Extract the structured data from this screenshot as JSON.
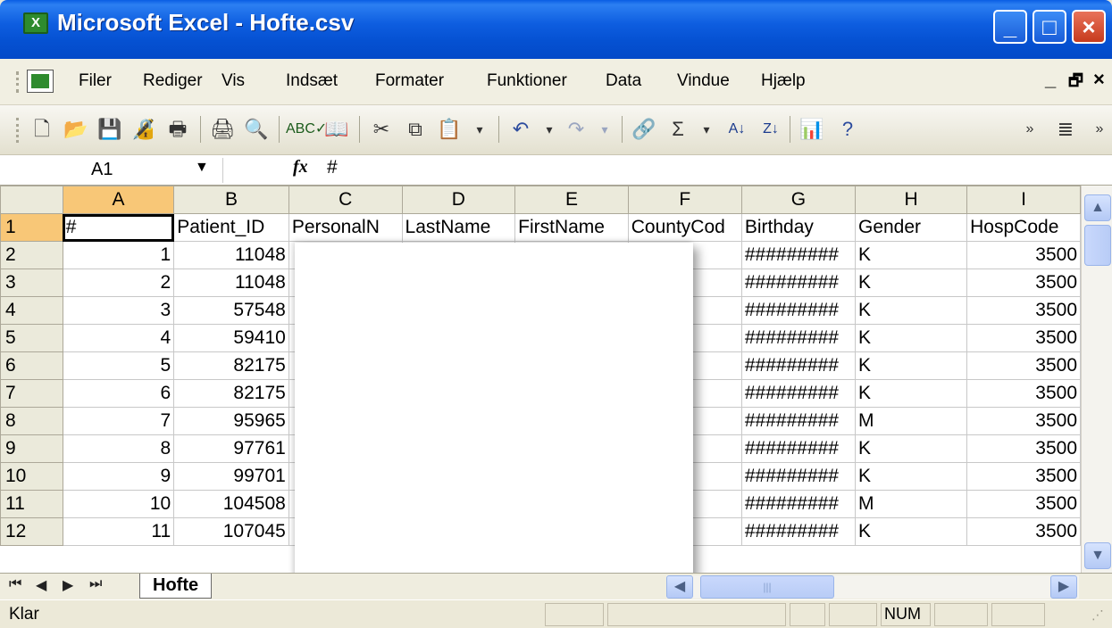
{
  "window": {
    "title": "Microsoft Excel - Hofte.csv"
  },
  "menu": {
    "items": [
      "Filer",
      "Rediger",
      "Vis",
      "Indsæt",
      "Formater",
      "Funktioner",
      "Data",
      "Vindue",
      "Hjælp"
    ]
  },
  "formula_bar": {
    "name_box": "A1",
    "fx": "fx",
    "value": "#"
  },
  "sheet": {
    "columns": [
      "A",
      "B",
      "C",
      "D",
      "E",
      "F",
      "G",
      "H",
      "I"
    ],
    "rows": [
      {
        "n": "1",
        "cells": [
          "#",
          "Patient_ID",
          "PersonalN",
          "LastName",
          "FirstName",
          "CountyCod",
          "Birthday",
          "Gender",
          "HospCode"
        ]
      },
      {
        "n": "2",
        "cells": [
          "1",
          "11048",
          "",
          "",
          "",
          "",
          "#########",
          "K",
          "3500"
        ]
      },
      {
        "n": "3",
        "cells": [
          "2",
          "11048",
          "",
          "",
          "",
          "",
          "#########",
          "K",
          "3500"
        ]
      },
      {
        "n": "4",
        "cells": [
          "3",
          "57548",
          "",
          "",
          "",
          "",
          "#########",
          "K",
          "3500"
        ]
      },
      {
        "n": "5",
        "cells": [
          "4",
          "59410",
          "",
          "",
          "",
          "",
          "#########",
          "K",
          "3500"
        ]
      },
      {
        "n": "6",
        "cells": [
          "5",
          "82175",
          "",
          "",
          "",
          "",
          "#########",
          "K",
          "3500"
        ]
      },
      {
        "n": "7",
        "cells": [
          "6",
          "82175",
          "",
          "",
          "",
          "",
          "#########",
          "K",
          "3500"
        ]
      },
      {
        "n": "8",
        "cells": [
          "7",
          "95965",
          "",
          "",
          "",
          "",
          "#########",
          "M",
          "3500"
        ]
      },
      {
        "n": "9",
        "cells": [
          "8",
          "97761",
          "",
          "",
          "",
          "",
          "#########",
          "K",
          "3500"
        ]
      },
      {
        "n": "10",
        "cells": [
          "9",
          "99701",
          "",
          "",
          "",
          "",
          "#########",
          "K",
          "3500"
        ]
      },
      {
        "n": "11",
        "cells": [
          "10",
          "104508",
          "",
          "",
          "",
          "",
          "#########",
          "M",
          "3500"
        ]
      },
      {
        "n": "12",
        "cells": [
          "11",
          "107045",
          "",
          "",
          "",
          "",
          "#########",
          "K",
          "3500"
        ]
      }
    ]
  },
  "sheet_tab": {
    "name": "Hofte"
  },
  "status": {
    "text": "Klar",
    "num": "NUM"
  },
  "colors": {
    "title_bar": "#0A5EE4",
    "selected_header": "#F8C777",
    "excel_green": "#2E8B2E"
  }
}
